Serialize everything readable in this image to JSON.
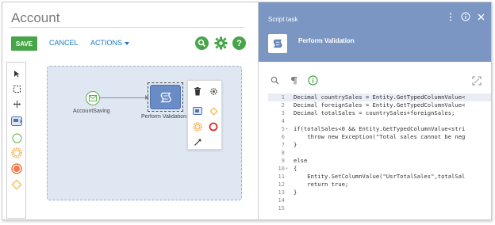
{
  "app": {
    "title": "Account"
  },
  "toolbar": {
    "save": "SAVE",
    "cancel": "CANCEL",
    "actions": "ACTIONS"
  },
  "colors": {
    "accent_green": "#47a448",
    "link_blue": "#1a77c9",
    "panel_header": "#7b96c2",
    "task_fill": "#6a8cc6",
    "canvas_bg": "#dfe7f2"
  },
  "palette": {
    "items": [
      "pointer-icon",
      "lasso-icon",
      "pan-icon",
      "task-icon",
      "start-event-icon",
      "intermediate-event-icon",
      "end-event-icon",
      "gateway-icon"
    ]
  },
  "diagram": {
    "start_label": "AccountSaving",
    "task_label": "Perform Validation"
  },
  "panel": {
    "title": "Script task",
    "task_name": "Perform Validation"
  },
  "code": {
    "lines": [
      {
        "n": "1",
        "text": "Decimal countrySales = Entity.GetTypedColumnValue<"
      },
      {
        "n": "2",
        "text": "Decimal foreignSales = Entity.GetTypedColumnValue<"
      },
      {
        "n": "3",
        "text": "Decimal totalSales = countrySales+foreignSales;"
      },
      {
        "n": "4",
        "text": ""
      },
      {
        "n": "5",
        "text": "if(totalSales<0 && Entity.GetTypedColumnValue<stri"
      },
      {
        "n": "6",
        "text": "    throw new Exception(\"Total sales cannot be neg"
      },
      {
        "n": "7",
        "text": "}"
      },
      {
        "n": "8",
        "text": ""
      },
      {
        "n": "9",
        "text": "else"
      },
      {
        "n": "10",
        "text": "{"
      },
      {
        "n": "11",
        "text": "    Entity.SetColumnValue(\"UsrTotalSales\",totalSal"
      },
      {
        "n": "12",
        "text": "    return true;"
      },
      {
        "n": "13",
        "text": "}"
      },
      {
        "n": "14",
        "text": ""
      },
      {
        "n": "15",
        "text": ""
      }
    ]
  }
}
